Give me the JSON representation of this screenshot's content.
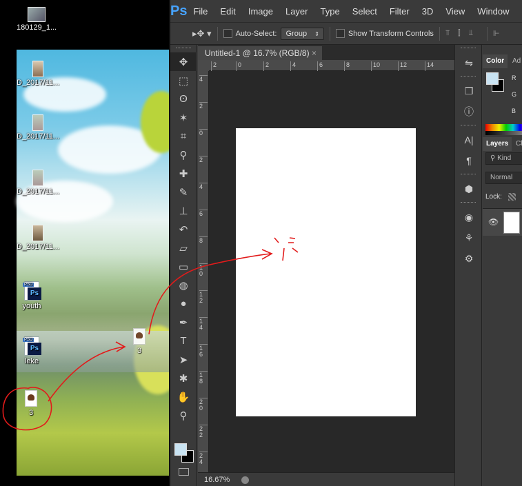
{
  "desktop": {
    "icons": [
      {
        "label": "180129_1...",
        "type": "image"
      },
      {
        "label": "D_2017/11...",
        "type": "image"
      },
      {
        "label": "D_2017/11...",
        "type": "image"
      },
      {
        "label": "D_2017/11...",
        "type": "image"
      },
      {
        "label": "D_2017/11...",
        "type": "image"
      },
      {
        "label": "youth",
        "type": "psd"
      },
      {
        "label": "leke",
        "type": "psd"
      },
      {
        "label": "3",
        "type": "file"
      }
    ],
    "dragging_icon": {
      "label": "3"
    },
    "psd_badge": "PSD",
    "ps_badge": "Ps"
  },
  "photoshop": {
    "logo": "Ps",
    "menu": [
      "File",
      "Edit",
      "Image",
      "Layer",
      "Type",
      "Select",
      "Filter",
      "3D",
      "View",
      "Window",
      "Help"
    ],
    "options": {
      "auto_select_label": "Auto-Select:",
      "auto_select_value": "Group",
      "show_transform_label": "Show Transform Controls"
    },
    "document": {
      "tab_title": "Untitled-1 @ 16.7% (RGB/8)",
      "zoom": "16.67%",
      "ruler_h": [
        "2",
        "0",
        "2",
        "4",
        "6",
        "8",
        "10",
        "12",
        "14"
      ],
      "ruler_v": [
        "4",
        "2",
        "0",
        "2",
        "4",
        "6",
        "8",
        "1 0",
        "1 2",
        "1 4",
        "1 6",
        "1 8",
        "2 0",
        "2 2",
        "2 4"
      ]
    },
    "tools": [
      "move-tool",
      "marquee-tool",
      "lasso-tool",
      "magic-wand-tool",
      "crop-tool",
      "eyedropper-tool",
      "healing-brush-tool",
      "brush-tool",
      "clone-stamp-tool",
      "history-brush-tool",
      "eraser-tool",
      "gradient-tool",
      "blur-tool",
      "dodge-tool",
      "pen-tool",
      "type-tool",
      "path-selection-tool",
      "shape-tool",
      "hand-tool",
      "zoom-tool"
    ],
    "colors": {
      "foreground": "#c9e3f2",
      "background": "#000000",
      "accent": "#47a3ff"
    },
    "panels": {
      "color_tab": "Color",
      "adjust_tab": "Ad",
      "rgb": [
        "R",
        "G",
        "B"
      ],
      "layers_tab": "Layers",
      "channels_tab": "Cl",
      "kind_placeholder": "Kind",
      "blend_mode": "Normal",
      "lock_label": "Lock:"
    }
  }
}
